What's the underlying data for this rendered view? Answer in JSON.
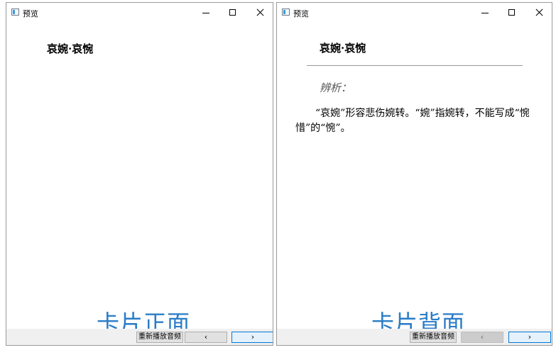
{
  "front": {
    "window_title": "预览",
    "card_title": "哀婉·哀惋",
    "caption": "卡片正面",
    "buttons": {
      "replay": "重新播放音频",
      "prev": "‹",
      "next": "›"
    }
  },
  "back": {
    "window_title": "预览",
    "card_title": "哀婉·哀惋",
    "analysis_label": "辨析：",
    "explanation": "“哀婉”形容悲伤婉转。“婉”指婉转，不能写成“惋惜”的“惋”。",
    "caption": "卡片背面",
    "buttons": {
      "replay": "重新播放音频",
      "prev": "‹",
      "next": "›"
    },
    "prev_disabled": true
  },
  "icons": {
    "app": "app-window-icon",
    "minimize": "minimize-icon",
    "maximize": "maximize-icon",
    "close": "close-icon"
  },
  "colors": {
    "caption": "#2a7cc7",
    "focus_border": "#0078d7"
  }
}
